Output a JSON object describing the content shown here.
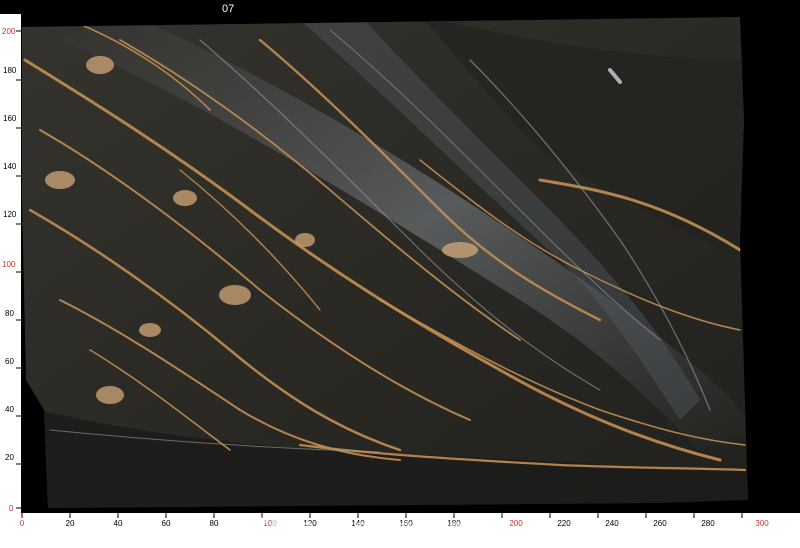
{
  "slab_label": "07",
  "watermark": "StoneContact.com",
  "ruler": {
    "x_ticks": [
      "0",
      "20",
      "40",
      "60",
      "80",
      "100",
      "120",
      "140",
      "160",
      "180",
      "200",
      "220",
      "240",
      "260",
      "280",
      "300"
    ],
    "y_ticks": [
      "200",
      "180",
      "160",
      "140",
      "120",
      "100",
      "80",
      "60",
      "40",
      "20",
      "0"
    ],
    "highlight_ticks": [
      "0",
      "100",
      "200",
      "300"
    ],
    "highlight_color": "#d03030",
    "tick_color": "#000000"
  },
  "colors": {
    "background": "#000000",
    "ruler_background": "#ffffff",
    "stone_base": "#2a2a26",
    "vein_gold": "#c48e52",
    "vein_light": "#d8b88a",
    "vein_grey": "#8a9096"
  }
}
